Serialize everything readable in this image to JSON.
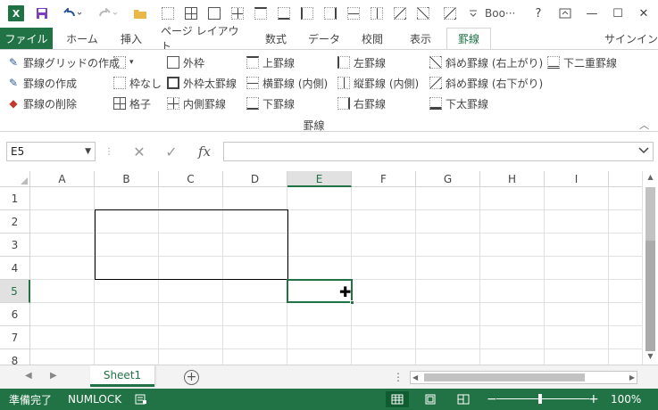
{
  "titlebar": {
    "logo": "X",
    "title": "Boo···",
    "icons": [
      "save-icon",
      "undo-icon",
      "redo-icon",
      "open-folder-icon"
    ],
    "controls": {
      "help": "?",
      "ribbon_display": "⧉",
      "minimize": "—",
      "maximize": "☐",
      "close": "✕"
    }
  },
  "tabs": {
    "file": "ファイル",
    "items": [
      "ホーム",
      "挿入",
      "ページ レイアウト",
      "数式",
      "データ",
      "校閲",
      "表示",
      "罫線"
    ],
    "active": "罫線",
    "signin": "サインイン"
  },
  "ribbon": {
    "col1": [
      "罫線グリッドの作成",
      "罫線の作成",
      "罫線の削除"
    ],
    "col2": [
      "",
      "枠なし",
      "格子"
    ],
    "col3": [
      "外枠",
      "外枠太罫線",
      "内側罫線"
    ],
    "col4": [
      "上罫線",
      "横罫線 (内側)",
      "下罫線"
    ],
    "col5": [
      "左罫線",
      "縦罫線 (内側)",
      "右罫線"
    ],
    "col6": [
      "斜め罫線 (右上がり)",
      "斜め罫線 (右下がり)",
      "下太罫線"
    ],
    "col7": [
      "下二重罫線"
    ],
    "group_label": "罫線",
    "collapse": "︿"
  },
  "formula_bar": {
    "name_box": "E5",
    "cancel": "✕",
    "enter": "✓",
    "fx": "fx",
    "value": ""
  },
  "grid": {
    "columns": [
      "A",
      "B",
      "C",
      "D",
      "E",
      "F",
      "G",
      "H",
      "I"
    ],
    "rows": [
      "1",
      "2",
      "3",
      "4",
      "5",
      "6",
      "7",
      "8"
    ],
    "selected_cell": "E5",
    "selected_column": "E",
    "selected_row": "5",
    "bordered_range": "B2:D4"
  },
  "sheets": {
    "tabs": [
      "Sheet1"
    ],
    "active": "Sheet1",
    "add": "+"
  },
  "status": {
    "ready": "準備完了",
    "numlock": "NUMLOCK",
    "zoom": "100%",
    "zoom_minus": "−",
    "zoom_plus": "+"
  },
  "colors": {
    "accent": "#217346",
    "status_bg": "#217346"
  }
}
